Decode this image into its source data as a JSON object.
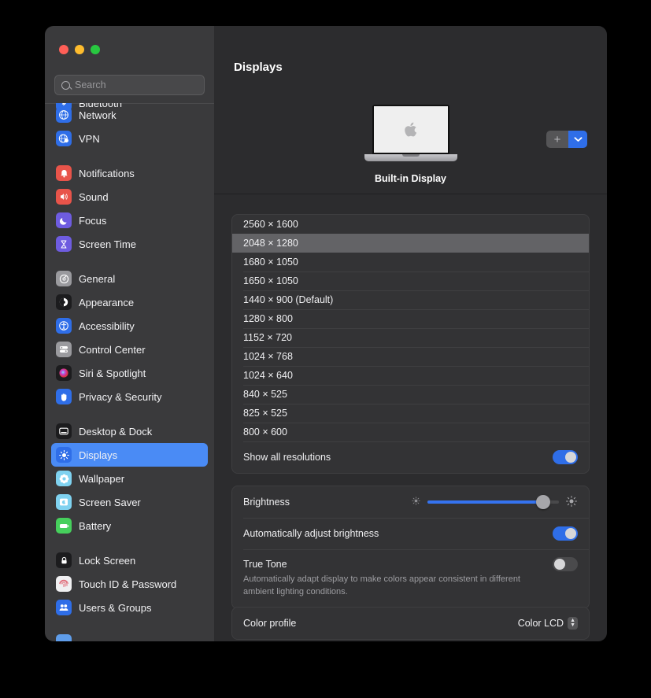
{
  "window": {
    "traffic_lights": [
      "close",
      "minimize",
      "zoom"
    ],
    "search": {
      "placeholder": "Search",
      "value": ""
    }
  },
  "sidebar": {
    "clipped_top_item": {
      "label": "Bluetooth"
    },
    "groups": [
      {
        "items": [
          {
            "label": "Network",
            "icon": "globe-icon",
            "selected": false
          },
          {
            "label": "VPN",
            "icon": "vpn-globe-icon",
            "selected": false
          }
        ]
      },
      {
        "items": [
          {
            "label": "Notifications",
            "icon": "bell-icon",
            "selected": false
          },
          {
            "label": "Sound",
            "icon": "speaker-icon",
            "selected": false
          },
          {
            "label": "Focus",
            "icon": "moon-icon",
            "selected": false
          },
          {
            "label": "Screen Time",
            "icon": "hourglass-icon",
            "selected": false
          }
        ]
      },
      {
        "items": [
          {
            "label": "General",
            "icon": "gear-icon",
            "selected": false
          },
          {
            "label": "Appearance",
            "icon": "contrast-circle-icon",
            "selected": false
          },
          {
            "label": "Accessibility",
            "icon": "accessibility-icon",
            "selected": false
          },
          {
            "label": "Control Center",
            "icon": "sliders-icon",
            "selected": false
          },
          {
            "label": "Siri & Spotlight",
            "icon": "siri-orb-icon",
            "selected": false
          },
          {
            "label": "Privacy & Security",
            "icon": "hand-icon",
            "selected": false
          }
        ]
      },
      {
        "items": [
          {
            "label": "Desktop & Dock",
            "icon": "desktop-dock-icon",
            "selected": false
          },
          {
            "label": "Displays",
            "icon": "brightness-icon",
            "selected": true
          },
          {
            "label": "Wallpaper",
            "icon": "flower-icon",
            "selected": false
          },
          {
            "label": "Screen Saver",
            "icon": "screensaver-icon",
            "selected": false
          },
          {
            "label": "Battery",
            "icon": "battery-icon",
            "selected": false
          }
        ]
      },
      {
        "items": [
          {
            "label": "Lock Screen",
            "icon": "lock-icon",
            "selected": false
          },
          {
            "label": "Touch ID & Password",
            "icon": "fingerprint-icon",
            "selected": false
          },
          {
            "label": "Users & Groups",
            "icon": "users-icon",
            "selected": false
          }
        ]
      }
    ]
  },
  "content": {
    "title": "Displays",
    "display_preview": {
      "device_icon": "macbook-icon",
      "label": "Built-in Display"
    },
    "add_button": {
      "plus_label": "+",
      "chevron_icon": "chevron-down-icon"
    },
    "resolutions": [
      {
        "label": "2560 × 1600",
        "selected": false
      },
      {
        "label": "2048 × 1280",
        "selected": true
      },
      {
        "label": "1680 × 1050",
        "selected": false
      },
      {
        "label": "1650 × 1050",
        "selected": false
      },
      {
        "label": "1440 × 900 (Default)",
        "selected": false
      },
      {
        "label": "1280 × 800",
        "selected": false
      },
      {
        "label": "1152 × 720",
        "selected": false
      },
      {
        "label": "1024 × 768",
        "selected": false
      },
      {
        "label": "1024 × 640",
        "selected": false
      },
      {
        "label": "840 × 525",
        "selected": false
      },
      {
        "label": "825 × 525",
        "selected": false
      },
      {
        "label": "800 × 600",
        "selected": false
      }
    ],
    "show_all_resolutions": {
      "label": "Show all resolutions",
      "on": true
    },
    "brightness": {
      "label": "Brightness",
      "value_percent": 88,
      "low_icon": "brightness-low-icon",
      "high_icon": "brightness-high-icon"
    },
    "auto_brightness": {
      "label": "Automatically adjust brightness",
      "on": true
    },
    "true_tone": {
      "label": "True Tone",
      "description": "Automatically adapt display to make colors appear consistent in different ambient lighting conditions.",
      "on": false
    },
    "color_profile": {
      "label": "Color profile",
      "value": "Color LCD",
      "stepper_icon": "up-down-chevron-icon"
    }
  },
  "colors": {
    "accent_blue": "#2f6ee8",
    "selection_blue": "#4a8bf5",
    "sidebar_bg": "#3a3a3c",
    "content_bg": "#2c2c2e",
    "panel_bg": "#333335"
  }
}
